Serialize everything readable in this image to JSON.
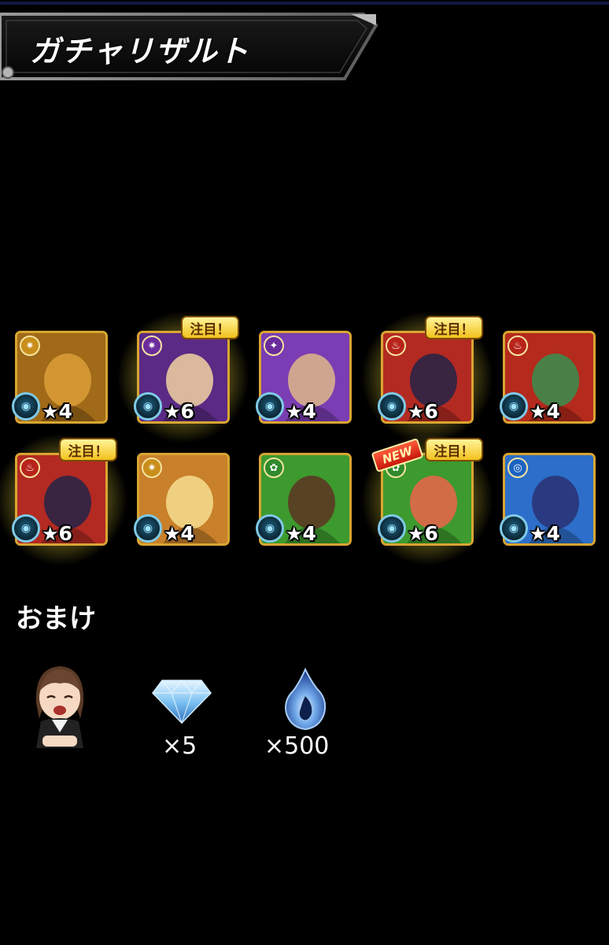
{
  "header": {
    "title": "ガチャリザルト"
  },
  "results": [
    {
      "name": "character-card",
      "rarity": "4",
      "element": "light",
      "element_color": "#c98e1a",
      "bg": "#a06a18",
      "art": "#d89b36",
      "glow": false,
      "highlight": "",
      "new": ""
    },
    {
      "name": "character-card",
      "rarity": "6",
      "element": "light",
      "element_color": "#6a2c9c",
      "bg": "#5b2a85",
      "art": "#e8c9a0",
      "glow": true,
      "highlight": "注目！",
      "new": ""
    },
    {
      "name": "character-card",
      "rarity": "4",
      "element": "dark",
      "element_color": "#6a2c9c",
      "bg": "#7b3db3",
      "art": "#d9b08c",
      "glow": false,
      "highlight": "",
      "new": ""
    },
    {
      "name": "character-card",
      "rarity": "6",
      "element": "fire",
      "element_color": "#b8231a",
      "bg": "#b32a22",
      "art": "#2b2446",
      "glow": true,
      "highlight": "注目！",
      "new": ""
    },
    {
      "name": "character-card",
      "rarity": "4",
      "element": "fire",
      "element_color": "#b8231a",
      "bg": "#b42a1c",
      "art": "#3d8a4c",
      "glow": false,
      "highlight": "",
      "new": ""
    },
    {
      "name": "character-card",
      "rarity": "6",
      "element": "fire",
      "element_color": "#b8231a",
      "bg": "#b32a22",
      "art": "#2b2446",
      "glow": true,
      "highlight": "注目！",
      "new": ""
    },
    {
      "name": "character-card",
      "rarity": "4",
      "element": "light",
      "element_color": "#c98e1a",
      "bg": "#c9802a",
      "art": "#f3d889",
      "glow": false,
      "highlight": "",
      "new": ""
    },
    {
      "name": "character-card",
      "rarity": "4",
      "element": "wood",
      "element_color": "#2f8a2b",
      "bg": "#3d9a2e",
      "art": "#5a3a22",
      "glow": false,
      "highlight": "",
      "new": ""
    },
    {
      "name": "character-card",
      "rarity": "6",
      "element": "wood",
      "element_color": "#2f8a2b",
      "bg": "#3d9a2e",
      "art": "#e2674a",
      "glow": true,
      "highlight": "注目！",
      "new": "NEW"
    },
    {
      "name": "character-card",
      "rarity": "4",
      "element": "water",
      "element_color": "#1d63c2",
      "bg": "#2c6ec9",
      "art": "#2a3478",
      "glow": false,
      "highlight": "",
      "new": ""
    }
  ],
  "bonus": {
    "heading": "おまけ",
    "items": [
      {
        "name": "avatar",
        "count": ""
      },
      {
        "name": "orb-diamond-icon",
        "count": "×5"
      },
      {
        "name": "blue-flame-icon",
        "count": "×500"
      }
    ]
  },
  "colors": {
    "background": "#000000",
    "badge": "#f2c11c",
    "orb_ring": "#7ec9e6"
  }
}
